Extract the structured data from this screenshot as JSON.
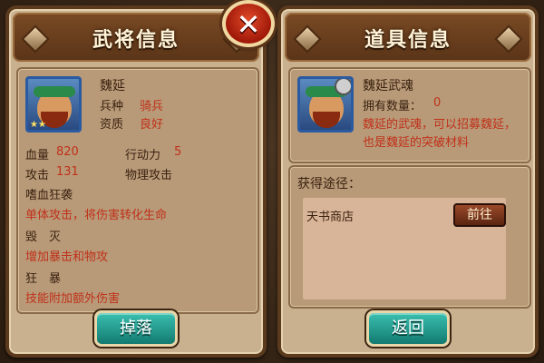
{
  "left_panel": {
    "title": "武将信息",
    "hero": {
      "name": "魏延",
      "troop_label": "兵种",
      "troop_value": "骑兵",
      "quality_label": "资质",
      "quality_value": "良好"
    },
    "stats": {
      "hp_label": "血量",
      "hp_value": "820",
      "ap_label": "行动力",
      "ap_value": "5",
      "atk_label": "攻击",
      "atk_value": "131",
      "atk_type": "物理攻击"
    },
    "skills": [
      {
        "name": "嗜血狂袭",
        "desc": "单体攻击，将伤害转化生命"
      },
      {
        "name": "毁　灭",
        "desc": "增加暴击和物攻"
      },
      {
        "name": "狂　暴",
        "desc": "技能附加额外伤害"
      }
    ],
    "drop_button": "掉落"
  },
  "close_button": "✕",
  "right_panel": {
    "title": "道具信息",
    "item": {
      "name": "魏延武魂",
      "owned_label": "拥有数量：",
      "owned_value": "0",
      "description": "魏延的武魂，可以招募魏延，也是魏延的突破材料"
    },
    "source_title": "获得途径：",
    "sources": [
      {
        "name": "天书商店",
        "button": "前往"
      }
    ],
    "back_button": "返回"
  },
  "colors": {
    "panel_bg": "#c9b190",
    "header_bg": "#5a3418",
    "value_red": "#c0301a",
    "button_teal": "#1f9e90",
    "close_red": "#c02a10"
  }
}
